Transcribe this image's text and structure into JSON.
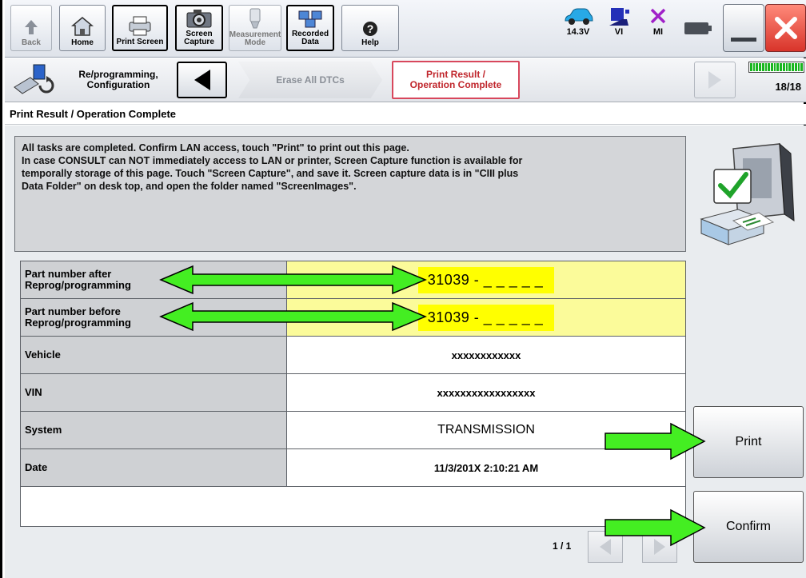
{
  "toolbar": {
    "back": "Back",
    "home": "Home",
    "print_screen": "Print Screen",
    "screen_capture_1": "Screen",
    "screen_capture_2": "Capture",
    "measurement_1": "Measurement",
    "measurement_2": "Mode",
    "recorded_1": "Recorded",
    "recorded_2": "Data",
    "help": "Help",
    "voltage": "14.3V",
    "vi": "VI",
    "mi": "MI"
  },
  "breadcrumb": {
    "title_1": "Re/programming,",
    "title_2": "Configuration",
    "step_erase": "Erase All DTCs",
    "step_print_1": "Print Result /",
    "step_print_2": "Operation Complete",
    "progress": "18/18",
    "progress_fraction": 1.0
  },
  "section": {
    "title": "Print Result / Operation Complete"
  },
  "message": {
    "line1": "All tasks are completed. Confirm LAN access, touch \"Print\" to print out this page.",
    "line2": "In case CONSULT can NOT immediately access to LAN or printer, Screen Capture function is available for",
    "line3": "temporally storage of this page. Touch \"Screen Capture\", and save it. Screen capture data is in \"CIII plus",
    "line4": "Data Folder\" on desk top, and open the folder named \"ScreenImages\"."
  },
  "table": {
    "rows": [
      {
        "label_1": "Part number after",
        "label_2": "Reprog/programming",
        "value": "31039 - _ _ _ _ _"
      },
      {
        "label_1": "Part number before",
        "label_2": "Reprog/programming",
        "value": "31039 - _ _ _ _ _"
      },
      {
        "label": "Vehicle",
        "value": "xxxxxxxxxxxx"
      },
      {
        "label": "VIN",
        "value": "xxxxxxxxxxxxxxxxx"
      },
      {
        "label": "System",
        "value": "TRANSMISSION"
      },
      {
        "label": "Date",
        "value": "11/3/201X 2:10:21 AM"
      }
    ]
  },
  "pager": {
    "text": "1 / 1"
  },
  "buttons": {
    "print": "Print",
    "confirm": "Confirm"
  },
  "colors": {
    "highlight_yellow": "#ffff00",
    "annotation_arrow": "#44ee22",
    "active_step": "#c0262c",
    "progress_green": "#19b51f"
  }
}
